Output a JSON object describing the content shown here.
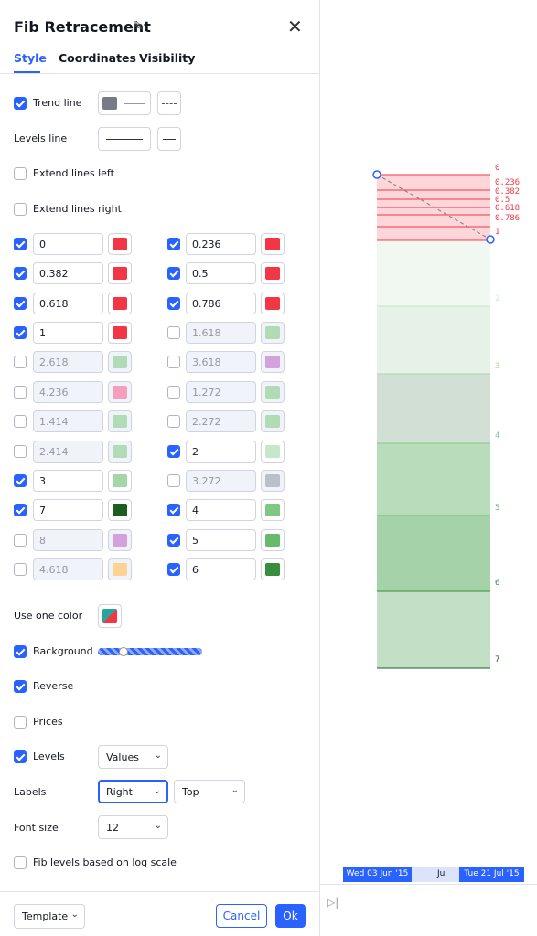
{
  "dialog": {
    "title": "Fib Retracement",
    "tabs": [
      {
        "label": "Style",
        "active": true
      },
      {
        "label": "Coordinates",
        "active": false
      },
      {
        "label": "Visibility",
        "active": false
      }
    ],
    "trend_line": {
      "label": "Trend line",
      "checked": true,
      "color": "#787b86"
    },
    "levels_line": {
      "label": "Levels line"
    },
    "extend_left": {
      "label": "Extend lines left",
      "checked": false
    },
    "extend_right": {
      "label": "Extend lines right",
      "checked": false
    },
    "levels": [
      {
        "value": "0",
        "checked": true,
        "color": "#f23645"
      },
      {
        "value": "0.236",
        "checked": true,
        "color": "#f23645"
      },
      {
        "value": "0.382",
        "checked": true,
        "color": "#f23645"
      },
      {
        "value": "0.5",
        "checked": true,
        "color": "#f23645"
      },
      {
        "value": "0.618",
        "checked": true,
        "color": "#f23645"
      },
      {
        "value": "0.786",
        "checked": true,
        "color": "#f23645"
      },
      {
        "value": "1",
        "checked": true,
        "color": "#f23645"
      },
      {
        "value": "1.618",
        "checked": false,
        "color": "#a5d6a7"
      },
      {
        "value": "2.618",
        "checked": false,
        "color": "#a5d6a7"
      },
      {
        "value": "3.618",
        "checked": false,
        "color": "#ce93d8"
      },
      {
        "value": "4.236",
        "checked": false,
        "color": "#f48fb1"
      },
      {
        "value": "1.272",
        "checked": false,
        "color": "#a5d6a7"
      },
      {
        "value": "1.414",
        "checked": false,
        "color": "#a5d6a7"
      },
      {
        "value": "2.272",
        "checked": false,
        "color": "#a5d6a7"
      },
      {
        "value": "2.414",
        "checked": false,
        "color": "#a5d6a7"
      },
      {
        "value": "2",
        "checked": true,
        "color": "#c8e6c9"
      },
      {
        "value": "3",
        "checked": true,
        "color": "#a5d6a7"
      },
      {
        "value": "3.272",
        "checked": false,
        "color": "#b2b5be"
      },
      {
        "value": "7",
        "checked": true,
        "color": "#1b5e20"
      },
      {
        "value": "4",
        "checked": true,
        "color": "#81c784"
      },
      {
        "value": "8",
        "checked": false,
        "color": "#ce93d8"
      },
      {
        "value": "5",
        "checked": true,
        "color": "#66bb6a"
      },
      {
        "value": "4.618",
        "checked": false,
        "color": "#ffcc80"
      },
      {
        "value": "6",
        "checked": true,
        "color": "#388e3c"
      }
    ],
    "use_one_color": {
      "label": "Use one color"
    },
    "background": {
      "label": "Background",
      "checked": true,
      "opacity_percent": 20
    },
    "reverse": {
      "label": "Reverse",
      "checked": true
    },
    "prices": {
      "label": "Prices",
      "checked": false
    },
    "levels_display": {
      "label": "Levels",
      "checked": true,
      "value": "Values"
    },
    "labels": {
      "label": "Labels",
      "horizontal": "Right",
      "vertical": "Top"
    },
    "font_size": {
      "label": "Font size",
      "value": "12"
    },
    "log_scale": {
      "label": "Fib levels based on log scale",
      "checked": false
    },
    "footer": {
      "template": "Template",
      "cancel": "Cancel",
      "ok": "Ok"
    }
  },
  "chart": {
    "level_labels_top": [
      "0",
      "0.236",
      "0.382",
      "0.5",
      "0.618",
      "0.786",
      "1"
    ],
    "level_labels_bottom": [
      "2",
      "3",
      "4",
      "5",
      "6",
      "7"
    ],
    "time_axis": {
      "start": "Wed 03 Jun '15",
      "middle": "Jul",
      "end": "Tue 21 Jul '15"
    }
  }
}
